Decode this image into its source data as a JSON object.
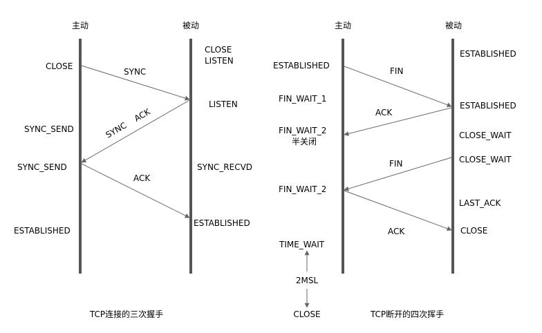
{
  "handshake": {
    "title": "TCP连接的三次握手",
    "active_label": "主动",
    "passive_label": "被动",
    "active_states": [
      "CLOSE",
      "SYNC_SEND",
      "SYNC_SEND",
      "ESTABLISHED"
    ],
    "passive_states": [
      "CLOSE",
      "LISTEN",
      "LISTEN",
      "SYNC_RECVD",
      "ESTABLISHED"
    ],
    "messages": [
      "SYNC",
      "SYNC    ACK",
      "ACK"
    ]
  },
  "teardown": {
    "title": "TCP断开的四次挥手",
    "active_label": "主动",
    "passive_label": "被动",
    "active_states": [
      "ESTABLISHED",
      "FIN_WAIT_1",
      "FIN_WAIT_2",
      "半关闭",
      "FIN_WAIT_2",
      "TIME_WAIT",
      "2MSL",
      "CLOSE"
    ],
    "passive_states": [
      "ESTABLISHED",
      "ESTABLISHED",
      "CLOSE_WAIT",
      "CLOSE_WAIT",
      "LAST_ACK",
      "CLOSE"
    ],
    "messages": [
      "FIN",
      "ACK",
      "FIN",
      "ACK"
    ]
  },
  "colors": {
    "lifeline": "#555555",
    "arrow": "#666666",
    "text": "#000000"
  }
}
